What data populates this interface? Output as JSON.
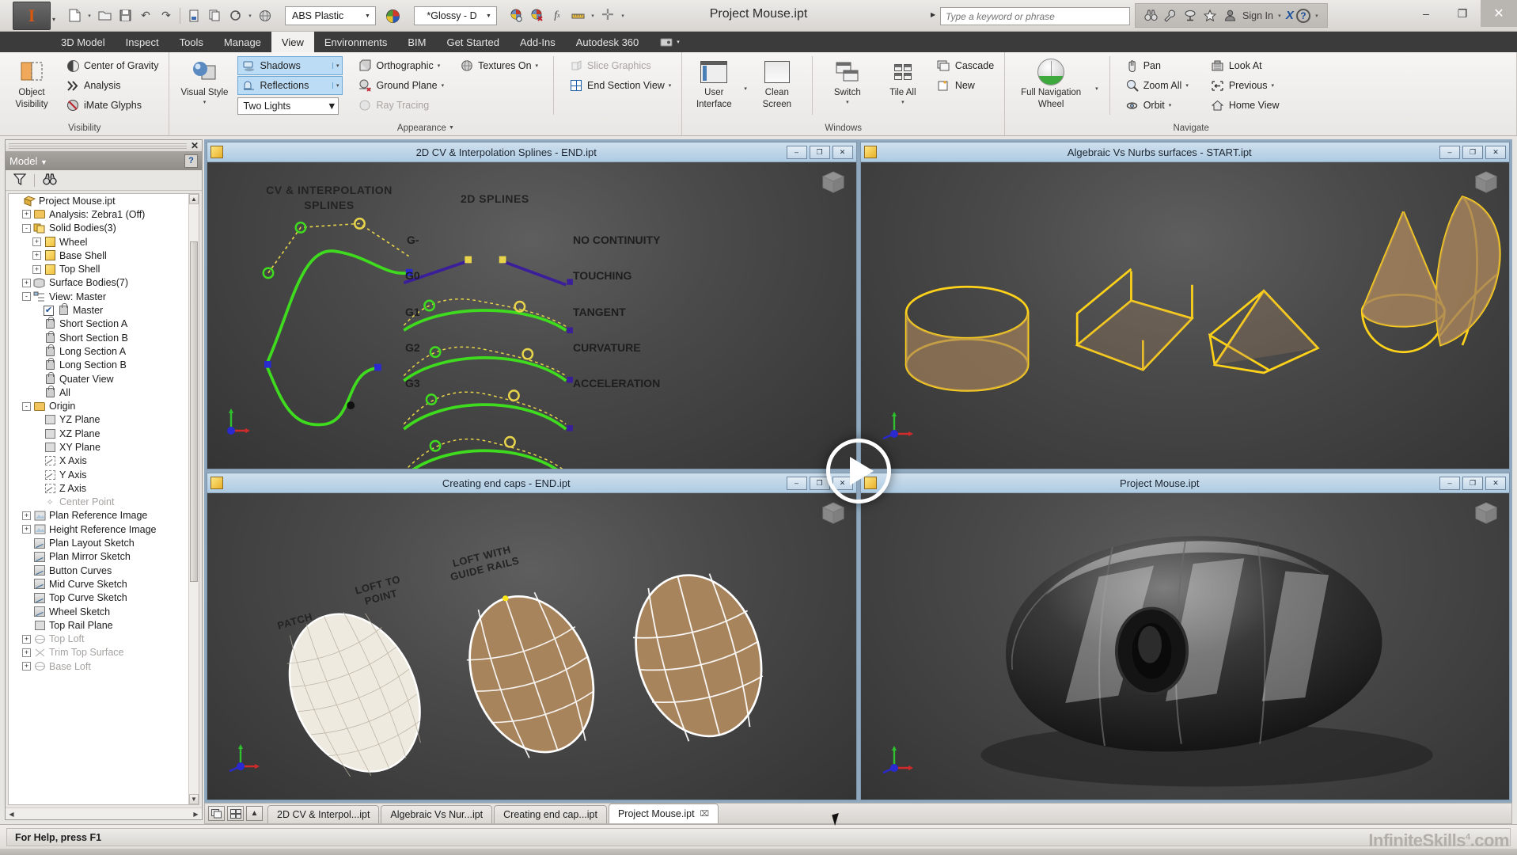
{
  "titlebar": {
    "app_icon": "inventor-logo-icon",
    "document_title": "Project Mouse.ipt",
    "material_combo": "ABS Plastic",
    "appearance_combo": "*Glossy - D",
    "search_placeholder": "Type a keyword or phrase",
    "sign_in_label": "Sign In",
    "help_label": "?",
    "minimize": "–",
    "maximize": "❐",
    "close": "✕",
    "quick_access": [
      {
        "name": "new-file-icon",
        "glyph": "⬜"
      },
      {
        "name": "open-file-icon",
        "glyph": "📂"
      },
      {
        "name": "save-icon",
        "glyph": "💾"
      },
      {
        "name": "undo-icon",
        "glyph": "↶"
      },
      {
        "name": "redo-icon",
        "glyph": "↷"
      },
      {
        "name": "parameters-icon",
        "glyph": "▤"
      },
      {
        "name": "copy-icon",
        "glyph": "⧉"
      },
      {
        "name": "update-icon",
        "glyph": "⟳"
      },
      {
        "name": "material-sphere-icon",
        "glyph": "●"
      }
    ]
  },
  "ribbon": {
    "tabs": [
      {
        "label": "3D Model",
        "active": false
      },
      {
        "label": "Inspect",
        "active": false
      },
      {
        "label": "Tools",
        "active": false
      },
      {
        "label": "Manage",
        "active": false
      },
      {
        "label": "View",
        "active": true
      },
      {
        "label": "Environments",
        "active": false
      },
      {
        "label": "BIM",
        "active": false
      },
      {
        "label": "Get Started",
        "active": false
      },
      {
        "label": "Add-Ins",
        "active": false
      },
      {
        "label": "Autodesk 360",
        "active": false
      }
    ],
    "panels": {
      "visibility": {
        "title": "Visibility",
        "object_visibility": "Object\nVisibility",
        "object_visibility_line1": "Object",
        "object_visibility_line2": "Visibility",
        "items": [
          {
            "label": "Center of Gravity",
            "icon": "center-of-gravity-icon",
            "disabled": false
          },
          {
            "label": "Analysis",
            "icon": "analysis-icon",
            "disabled": false
          },
          {
            "label": "iMate Glyphs",
            "icon": "imate-glyphs-icon",
            "disabled": false
          }
        ]
      },
      "appearance": {
        "title": "Appearance",
        "visual_style_line1": "Visual Style",
        "toggles": [
          {
            "label": "Shadows",
            "icon": "shadows-icon",
            "active": true
          },
          {
            "label": "Reflections",
            "icon": "reflections-icon",
            "active": true
          }
        ],
        "lighting_style": "Two Lights",
        "items": [
          {
            "label": "Orthographic",
            "icon": "orthographic-icon",
            "disabled": false,
            "caret": true
          },
          {
            "label": "Ground Plane",
            "icon": "ground-plane-icon",
            "disabled": false,
            "caret": true
          },
          {
            "label": "Ray Tracing",
            "icon": "ray-tracing-icon",
            "disabled": true,
            "caret": false
          },
          {
            "label": "Textures On",
            "icon": "textures-icon",
            "disabled": false,
            "caret": true
          }
        ],
        "section_items": [
          {
            "label": "Slice Graphics",
            "icon": "slice-graphics-icon",
            "disabled": true,
            "caret": false
          },
          {
            "label": "End Section View",
            "icon": "end-section-view-icon",
            "disabled": false,
            "caret": true
          }
        ]
      },
      "windows": {
        "title": "Windows",
        "user_interface_l1": "User",
        "user_interface_l2": "Interface",
        "clean_screen_l1": "Clean",
        "clean_screen_l2": "Screen",
        "switch_label": "Switch",
        "tile_all_label": "Tile All",
        "items": [
          {
            "label": "Cascade",
            "icon": "cascade-icon"
          },
          {
            "label": "New",
            "icon": "new-window-icon"
          }
        ]
      },
      "navigate": {
        "title": "Navigate",
        "wheel_l1": "Full Navigation",
        "wheel_l2": "Wheel",
        "col1": [
          {
            "label": "Pan",
            "icon": "pan-hand-icon",
            "caret": false
          },
          {
            "label": "Zoom All",
            "icon": "zoom-all-icon",
            "caret": true
          },
          {
            "label": "Orbit",
            "icon": "orbit-icon",
            "caret": true
          }
        ],
        "col2": [
          {
            "label": "Look At",
            "icon": "look-at-icon",
            "caret": false
          },
          {
            "label": "Previous",
            "icon": "previous-view-icon",
            "caret": true
          },
          {
            "label": "Home View",
            "icon": "home-view-icon",
            "caret": false
          }
        ]
      }
    }
  },
  "browser": {
    "panel_title": "Model",
    "help_badge": "?",
    "close_glyph": "✕",
    "filter_icon": "filter-icon",
    "find_icon": "binoculars-icon",
    "tree": [
      {
        "label": "Project Mouse.ipt",
        "depth": 0,
        "exp": "",
        "icon": "part-file-icon",
        "dim": false
      },
      {
        "label": "Analysis: Zebra1 (Off)",
        "depth": 1,
        "exp": "+",
        "icon": "folder-icon",
        "dim": false
      },
      {
        "label": "Solid Bodies(3)",
        "depth": 1,
        "exp": "-",
        "icon": "solid-bodies-icon",
        "dim": false
      },
      {
        "label": "Wheel",
        "depth": 2,
        "exp": "+",
        "icon": "body-icon",
        "dim": false
      },
      {
        "label": "Base Shell",
        "depth": 2,
        "exp": "+",
        "icon": "body-icon",
        "dim": false
      },
      {
        "label": "Top Shell",
        "depth": 2,
        "exp": "+",
        "icon": "body-icon",
        "dim": false
      },
      {
        "label": "Surface Bodies(7)",
        "depth": 1,
        "exp": "+",
        "icon": "surface-bodies-icon",
        "dim": false
      },
      {
        "label": "View: Master",
        "depth": 1,
        "exp": "-",
        "icon": "view-icon",
        "dim": false
      },
      {
        "label": "Master",
        "depth": 2,
        "exp": "",
        "icon": "lock-icon",
        "dim": false,
        "check": true
      },
      {
        "label": "Short Section A",
        "depth": 2,
        "exp": "",
        "icon": "lock-icon",
        "dim": false
      },
      {
        "label": "Short Section B",
        "depth": 2,
        "exp": "",
        "icon": "lock-icon",
        "dim": false
      },
      {
        "label": "Long Section A",
        "depth": 2,
        "exp": "",
        "icon": "lock-icon",
        "dim": false
      },
      {
        "label": "Long Section B",
        "depth": 2,
        "exp": "",
        "icon": "lock-icon",
        "dim": false
      },
      {
        "label": "Quater View",
        "depth": 2,
        "exp": "",
        "icon": "lock-icon",
        "dim": false
      },
      {
        "label": "All",
        "depth": 2,
        "exp": "",
        "icon": "lock-icon",
        "dim": false
      },
      {
        "label": "Origin",
        "depth": 1,
        "exp": "-",
        "icon": "folder-icon",
        "dim": false
      },
      {
        "label": "YZ Plane",
        "depth": 2,
        "exp": "",
        "icon": "plane-icon",
        "dim": false
      },
      {
        "label": "XZ Plane",
        "depth": 2,
        "exp": "",
        "icon": "plane-icon",
        "dim": false
      },
      {
        "label": "XY Plane",
        "depth": 2,
        "exp": "",
        "icon": "plane-icon",
        "dim": false
      },
      {
        "label": "X Axis",
        "depth": 2,
        "exp": "",
        "icon": "axis-icon",
        "dim": false
      },
      {
        "label": "Y Axis",
        "depth": 2,
        "exp": "",
        "icon": "axis-icon",
        "dim": false
      },
      {
        "label": "Z Axis",
        "depth": 2,
        "exp": "",
        "icon": "axis-icon",
        "dim": false
      },
      {
        "label": "Center Point",
        "depth": 2,
        "exp": "",
        "icon": "center-point-icon",
        "dim": true
      },
      {
        "label": "Plan Reference Image",
        "depth": 1,
        "exp": "+",
        "icon": "reference-image-icon",
        "dim": false
      },
      {
        "label": "Height Reference Image",
        "depth": 1,
        "exp": "+",
        "icon": "reference-image-icon",
        "dim": false
      },
      {
        "label": "Plan Layout Sketch",
        "depth": 1,
        "exp": "",
        "icon": "sketch-icon",
        "dim": false
      },
      {
        "label": "Plan Mirror Sketch",
        "depth": 1,
        "exp": "",
        "icon": "sketch-icon",
        "dim": false
      },
      {
        "label": "Button Curves",
        "depth": 1,
        "exp": "",
        "icon": "sketch-icon",
        "dim": false
      },
      {
        "label": "Mid Curve Sketch",
        "depth": 1,
        "exp": "",
        "icon": "sketch-icon",
        "dim": false
      },
      {
        "label": "Top Curve Sketch",
        "depth": 1,
        "exp": "",
        "icon": "sketch-icon",
        "dim": false
      },
      {
        "label": "Wheel Sketch",
        "depth": 1,
        "exp": "",
        "icon": "sketch-icon",
        "dim": false
      },
      {
        "label": "Top Rail Plane",
        "depth": 1,
        "exp": "",
        "icon": "plane-icon",
        "dim": false
      },
      {
        "label": "Top Loft",
        "depth": 1,
        "exp": "+",
        "icon": "loft-icon",
        "dim": true
      },
      {
        "label": "Trim Top Surface",
        "depth": 1,
        "exp": "+",
        "icon": "trim-icon",
        "dim": true
      },
      {
        "label": "Base Loft",
        "depth": 1,
        "exp": "+",
        "icon": "loft-icon",
        "dim": true
      }
    ]
  },
  "viewports": [
    {
      "name": "viewport-splines",
      "title": "2D CV & Interpolation Splines - END.ipt",
      "minimize": "–",
      "restore": "❐",
      "close": "✕",
      "labels": {
        "heading_left_l1": "CV & INTERPOLATION",
        "heading_left_l2": "SPLINES",
        "heading_right": "2D SPLINES",
        "continuity_codes": [
          "G-",
          "G0",
          "G1",
          "G2",
          "G3"
        ],
        "continuity_names": [
          "NO CONTINUITY",
          "TOUCHING",
          "TANGENT",
          "CURVATURE",
          "ACCELERATION"
        ]
      }
    },
    {
      "name": "viewport-nurbs",
      "title": "Algebraic Vs Nurbs surfaces - START.ipt",
      "minimize": "–",
      "restore": "❐",
      "close": "✕",
      "labels": {}
    },
    {
      "name": "viewport-endcaps",
      "title": "Creating end caps - END.ipt",
      "minimize": "–",
      "restore": "❐",
      "close": "✕",
      "labels": {
        "patch": "PATCH",
        "loft_to_point_l1": "LOFT TO",
        "loft_to_point_l2": "POINT",
        "loft_guide_l1": "LOFT WITH",
        "loft_guide_l2": "GUIDE RAILS"
      }
    },
    {
      "name": "viewport-mouse",
      "title": "Project Mouse.ipt",
      "minimize": "–",
      "restore": "❐",
      "close": "✕",
      "labels": {}
    }
  ],
  "play_overlay": {
    "name": "play-button",
    "glyph": "▶"
  },
  "document_tabs": [
    {
      "label": "2D CV & Interpol...ipt",
      "active": false,
      "close": ""
    },
    {
      "label": "Algebraic Vs Nur...ipt",
      "active": false,
      "close": ""
    },
    {
      "label": "Creating end cap...ipt",
      "active": false,
      "close": ""
    },
    {
      "label": "Project Mouse.ipt",
      "active": true,
      "close": "⌧"
    }
  ],
  "statusbar": {
    "help_text": "For Help, press F1",
    "watermark": "InfiniteSkills",
    "watermark_sup": "4",
    "watermark_tld": ".com"
  },
  "colors": {
    "accent_blue": "#bcdcf5",
    "title_blue": "#aecbe2",
    "spline_green": "#3fdb1f",
    "spline_yellow": "#e8d44a",
    "nurbs_yellow": "#ffd21a",
    "surface_tan": "#a8845c",
    "ribbon_dark": "#3b3b3b"
  }
}
